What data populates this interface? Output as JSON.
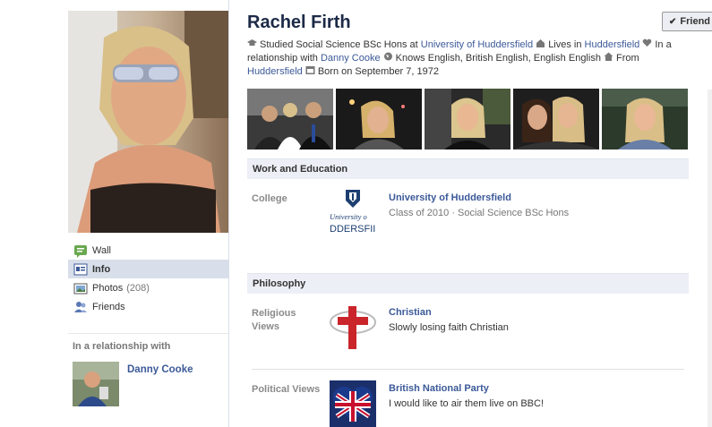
{
  "profile": {
    "name": "Rachel Firth",
    "friend_button": "Friend",
    "bio": {
      "studied_prefix": "Studied Social Science BSc Hons at",
      "school": "University of Huddersfield",
      "lives_prefix": "Lives in",
      "lives_city": "Huddersfield",
      "relationship_prefix": "In a relationship with",
      "partner": "Danny Cooke",
      "languages": "Knows English, British English, English English",
      "from_prefix": "From",
      "from_city": "Huddersfield",
      "born": "Born on September 7, 1972"
    }
  },
  "nav": {
    "items": [
      {
        "label": "Wall",
        "icon": "wall-icon"
      },
      {
        "label": "Info",
        "icon": "info-icon",
        "active": true
      },
      {
        "label": "Photos",
        "count": "(208)",
        "icon": "photos-icon"
      },
      {
        "label": "Friends",
        "icon": "friends-icon"
      }
    ]
  },
  "relationship": {
    "heading": "In a relationship with",
    "name": "Danny Cooke"
  },
  "sections": {
    "work": {
      "header": "Work and Education",
      "college_label": "College",
      "college_name": "University of Huddersfield",
      "college_detail": "Class of 2010 · Social Science BSc Hons",
      "logo_text1": "University o",
      "logo_text2": "DDERSFII"
    },
    "philosophy": {
      "header": "Philosophy",
      "religious_label": "Religious Views",
      "religion": "Christian",
      "religion_detail": "Slowly losing faith Christian",
      "political_label": "Political Views",
      "party": "British National Party",
      "party_detail": "I would like to air them live on BBC!"
    }
  },
  "colors": {
    "link": "#3b5998",
    "header_bg": "#eceff5",
    "active_nav": "#d8dfea"
  }
}
